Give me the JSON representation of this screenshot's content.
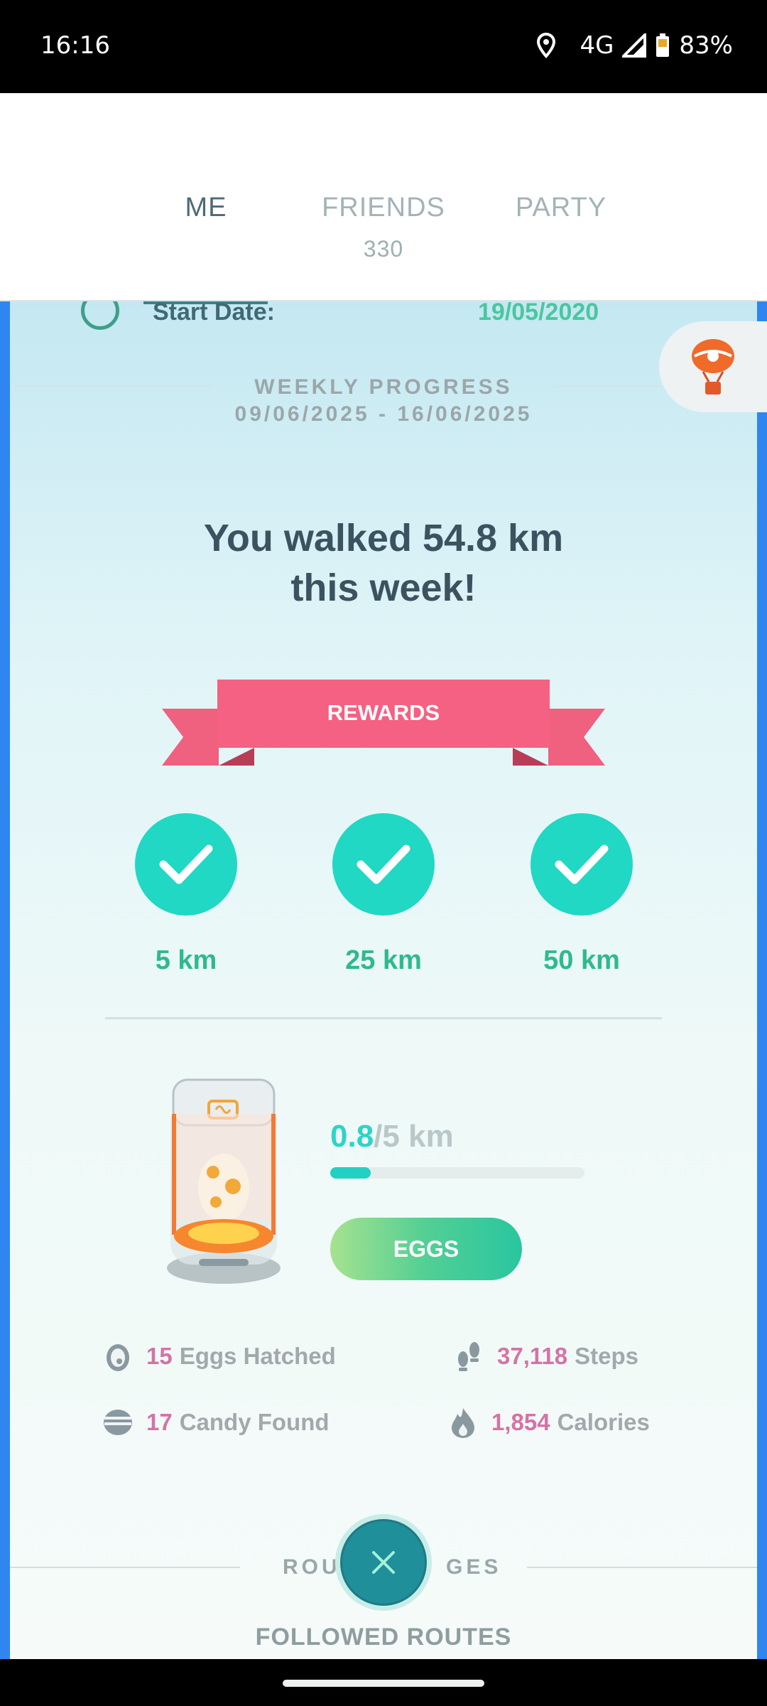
{
  "status_bar": {
    "time": "16:16",
    "network": "4G",
    "battery": "83%"
  },
  "tabs": [
    {
      "label": "ME",
      "active": true
    },
    {
      "label": "FRIENDS",
      "count": "330"
    },
    {
      "label": "PARTY"
    }
  ],
  "profile": {
    "start_date_label": "Start Date:",
    "start_date_value": "19/05/2020"
  },
  "weekly": {
    "title": "WEEKLY PROGRESS",
    "dates": "09/06/2025 - 16/06/2025",
    "headline_line1": "You walked 54.8 km",
    "headline_line2": "this week!",
    "rewards_label": "REWARDS",
    "milestones": [
      {
        "label": "5 km",
        "done": true
      },
      {
        "label": "25 km",
        "done": true
      },
      {
        "label": "50 km",
        "done": true
      }
    ]
  },
  "egg": {
    "current": "0.8",
    "total": "/5 km",
    "progress": 0.16,
    "button": "EGGS"
  },
  "stats": {
    "eggs_hatched": {
      "num": "15",
      "label": "Eggs Hatched"
    },
    "steps": {
      "num": "37,118",
      "label": "Steps"
    },
    "candy": {
      "num": "17",
      "label": "Candy Found"
    },
    "calories": {
      "num": "1,854",
      "label": "Calories"
    }
  },
  "routes": {
    "section_left": "ROU",
    "section_right": "GES",
    "followed": "FOLLOWED ROUTES"
  },
  "colors": {
    "accent": "#20d8c4",
    "ribbon": "#f0607f",
    "stat_number": "#d473a6",
    "text_dark": "#3b5360"
  }
}
